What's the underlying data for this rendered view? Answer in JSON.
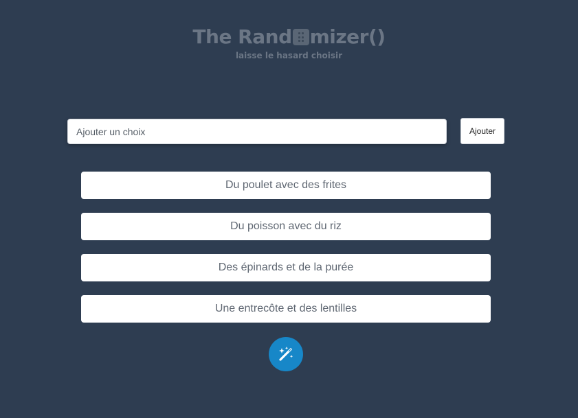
{
  "header": {
    "title_before": "The Rand",
    "title_after": "mizer()",
    "title_icon": "dice-icon",
    "subtitle": "laisse le hasard choisir"
  },
  "form": {
    "placeholder": "Ajouter un choix",
    "value": "",
    "add_label": "Ajouter"
  },
  "choices": [
    "Du poulet avec des frites",
    "Du poisson avec du riz",
    "Des épinards et de la purée",
    "Une entrecôte et des lentilles"
  ],
  "randomize_button": {
    "icon": "magic-wand-icon",
    "color": "#1787c8"
  },
  "colors": {
    "background": "#2e3d51",
    "title": "#6b7685",
    "card": "#ffffff",
    "card_text": "#5f6772"
  }
}
